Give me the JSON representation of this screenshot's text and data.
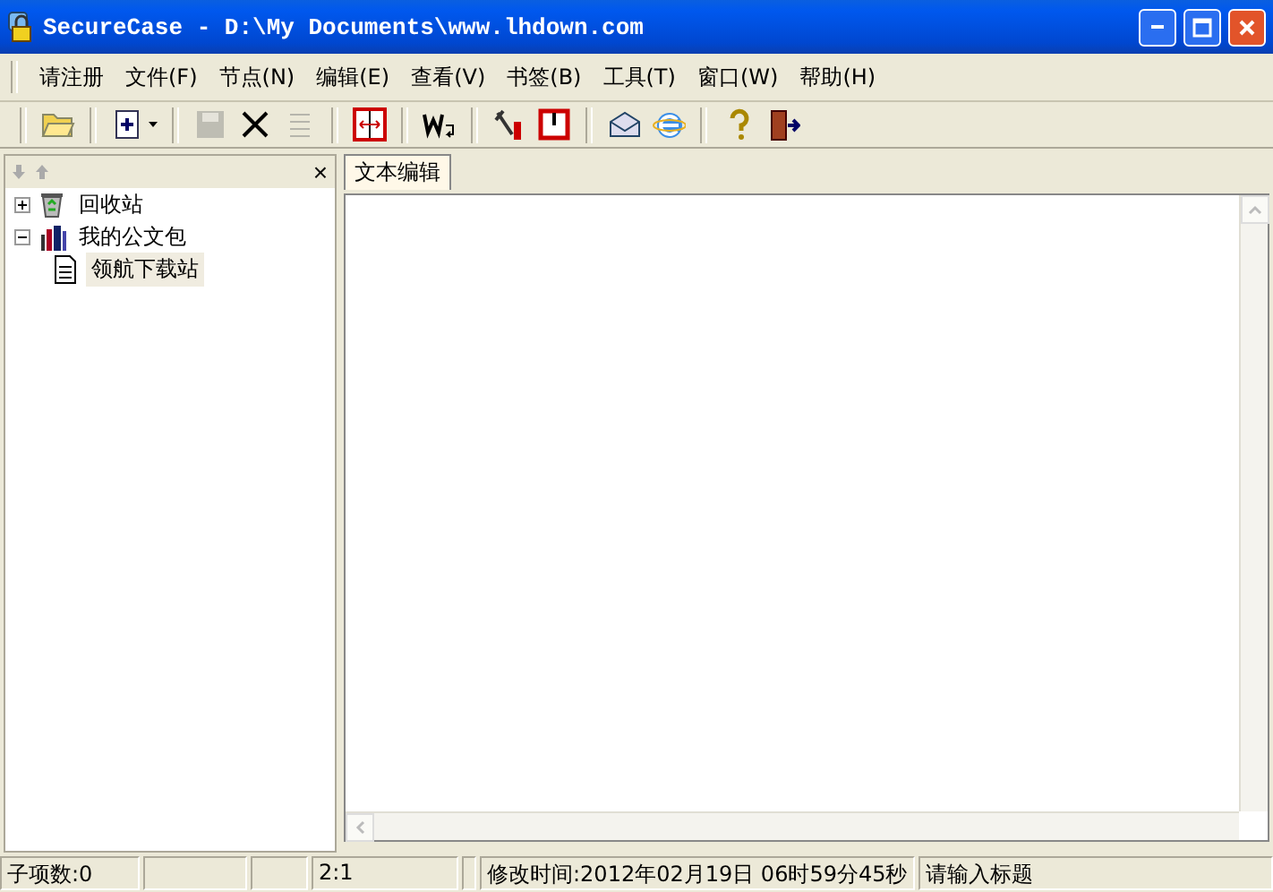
{
  "window": {
    "title": "SecureCase - D:\\My Documents\\www.lhdown.com"
  },
  "menu": [
    {
      "label": "请注册"
    },
    {
      "label": "文件(F)"
    },
    {
      "label": "节点(N)"
    },
    {
      "label": "编辑(E)"
    },
    {
      "label": "查看(V)"
    },
    {
      "label": "书签(B)"
    },
    {
      "label": "工具(T)"
    },
    {
      "label": "窗口(W)"
    },
    {
      "label": "帮助(H)"
    }
  ],
  "toolbar": [
    [
      {
        "disabled": false
      }
    ],
    [
      {
        "disabled": false
      }
    ],
    [
      {
        "disabled": true
      },
      {
        "disabled": false
      },
      {
        "disabled": true
      }
    ],
    [
      {
        "disabled": false
      }
    ],
    [
      {
        "disabled": false
      }
    ],
    [
      {
        "disabled": false
      },
      {
        "disabled": false
      }
    ],
    [
      {
        "disabled": false
      },
      {
        "disabled": false
      }
    ],
    [
      {
        "disabled": false
      },
      {
        "disabled": false
      }
    ]
  ],
  "sidebar": {
    "close": "×",
    "tree": [
      {
        "label": "回收站",
        "kind": "recycle",
        "expanded": false,
        "selected": false
      },
      {
        "label": "我的公文包",
        "kind": "briefcase",
        "expanded": true,
        "selected": false,
        "children": [
          {
            "label": "领航下载站",
            "kind": "document",
            "selected": true
          }
        ]
      }
    ]
  },
  "tabs": [
    {
      "label": "文本编辑",
      "selected": true
    }
  ],
  "status_bar": [
    {
      "kind": "text",
      "text": "子项数:0"
    },
    {
      "kind": "empty"
    },
    {
      "kind": "empty"
    },
    {
      "kind": "text",
      "text": "2:1"
    },
    {
      "kind": "empty"
    },
    {
      "kind": "text",
      "text": "修改时间:2012年02月19日 06时59分45秒"
    },
    {
      "kind": "text",
      "text": "请输入标题"
    }
  ]
}
